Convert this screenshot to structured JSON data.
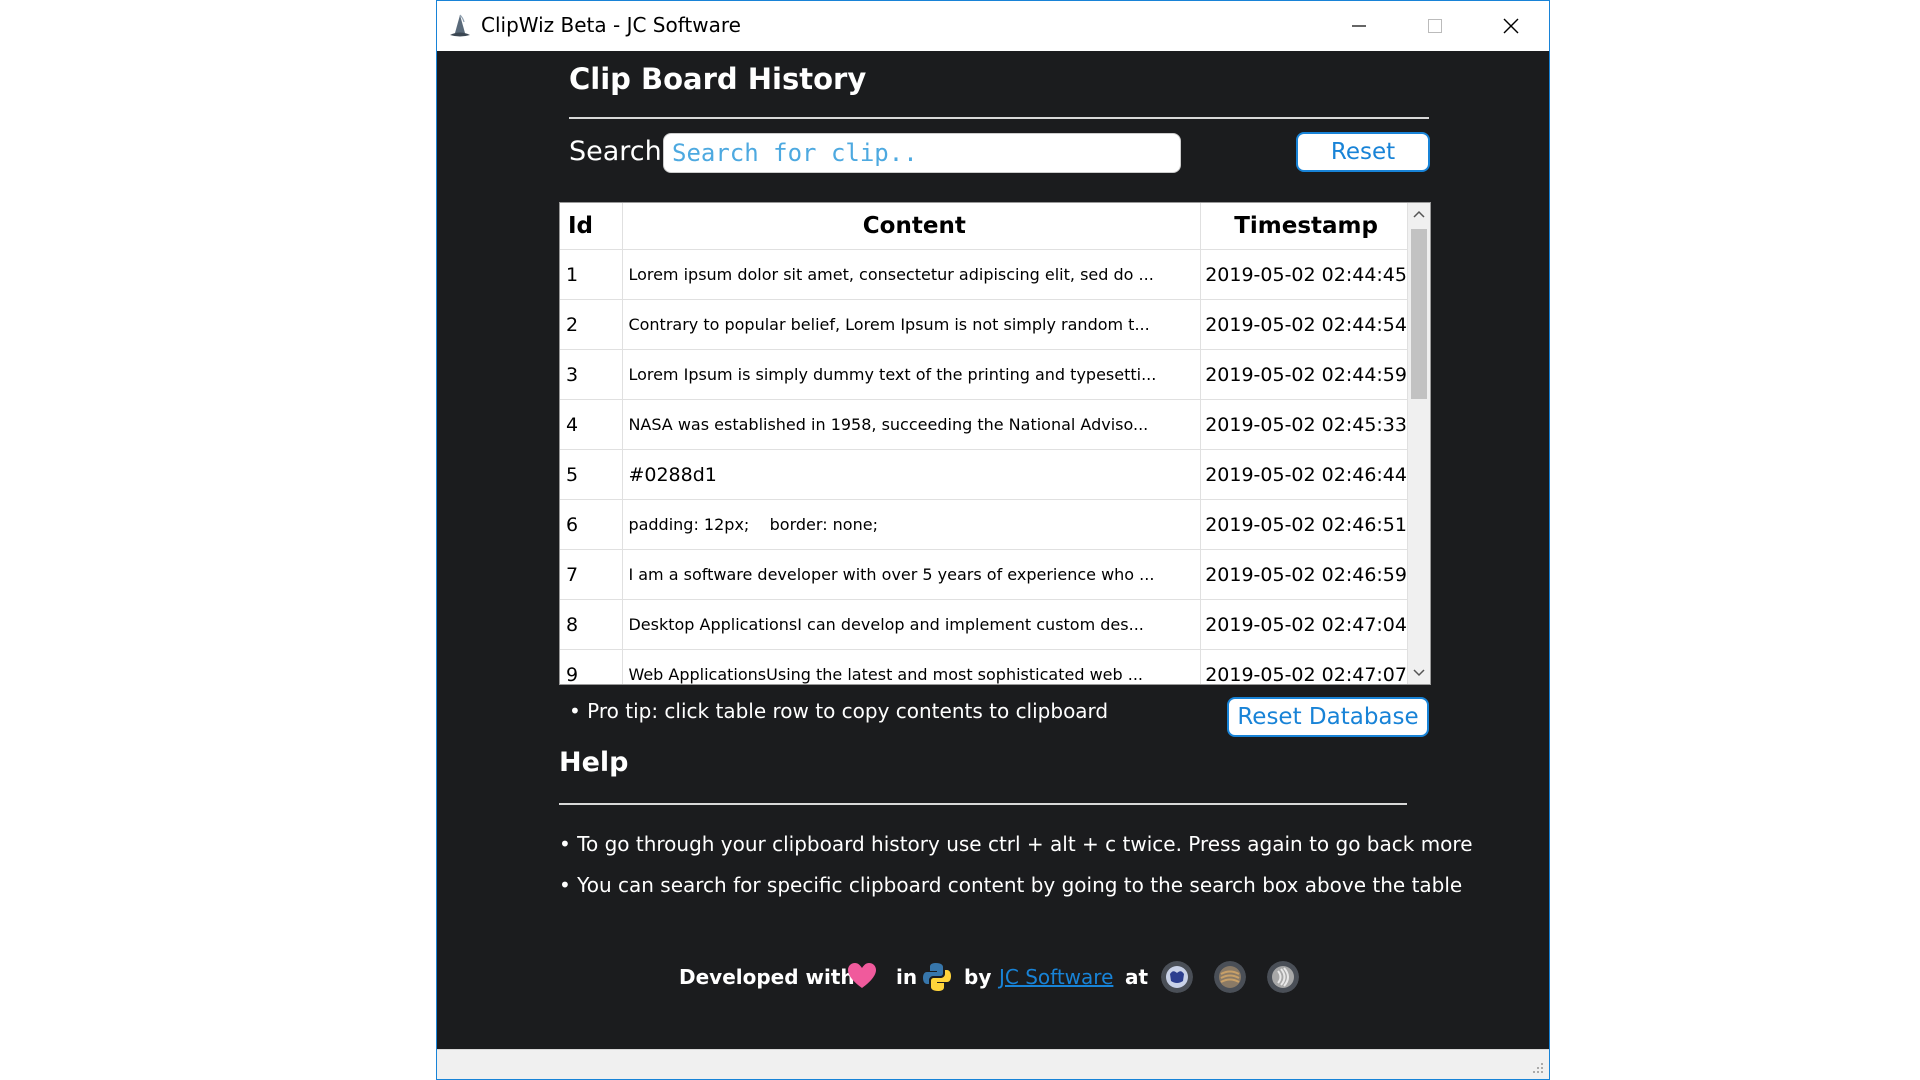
{
  "window": {
    "title": "ClipWiz Beta - JC Software"
  },
  "history": {
    "heading": "Clip Board History",
    "search_label": "Search",
    "search_placeholder": "Search for clip..",
    "search_value": "",
    "reset_label": "Reset",
    "columns": [
      "Id",
      "Content",
      "Timestamp"
    ],
    "rows": [
      {
        "id": "1",
        "content": "Lorem ipsum dolor sit amet, consectetur adipiscing elit, sed do ...",
        "timestamp": "2019-05-02 02:44:45"
      },
      {
        "id": "2",
        "content": "Contrary to popular belief, Lorem Ipsum is not simply random t...",
        "timestamp": "2019-05-02 02:44:54"
      },
      {
        "id": "3",
        "content": "Lorem Ipsum is simply dummy text of the printing and typesetti...",
        "timestamp": "2019-05-02 02:44:59"
      },
      {
        "id": "4",
        "content": "NASA was established in 1958, succeeding the National Adviso...",
        "timestamp": "2019-05-02 02:45:33"
      },
      {
        "id": "5",
        "content": "#0288d1",
        "timestamp": "2019-05-02 02:46:44"
      },
      {
        "id": "6",
        "content": "padding: 12px;    border: none;",
        "timestamp": "2019-05-02 02:46:51"
      },
      {
        "id": "7",
        "content": "I am a software developer with over 5 years of experience who ...",
        "timestamp": "2019-05-02 02:46:59"
      },
      {
        "id": "8",
        "content": "Desktop ApplicationsI can develop and implement custom des...",
        "timestamp": "2019-05-02 02:47:04"
      },
      {
        "id": "9",
        "content": "Web ApplicationsUsing the latest and most sophisticated web ...",
        "timestamp": "2019-05-02 02:47:07"
      }
    ],
    "protip": "• Pro tip: click table row to copy contents to clipboard",
    "reset_db_label": "Reset Database"
  },
  "help": {
    "heading": "Help",
    "lines": [
      "• To go through your clipboard history use ctrl + alt + c twice. Press again to go back more",
      "• You can search for specific clipboard content by going to the search box above the table"
    ]
  },
  "footer": {
    "developed_with": "Developed with",
    "in": "in",
    "by": "by",
    "company_link": "JC Software",
    "at": "at",
    "icons": [
      "heart-icon",
      "python-icon",
      "github-icon",
      "codepen-icon",
      "soundcloud-icon"
    ]
  },
  "colors": {
    "accent": "#1883d7",
    "background": "#1b1c1e",
    "heart": "#f05a9c"
  }
}
